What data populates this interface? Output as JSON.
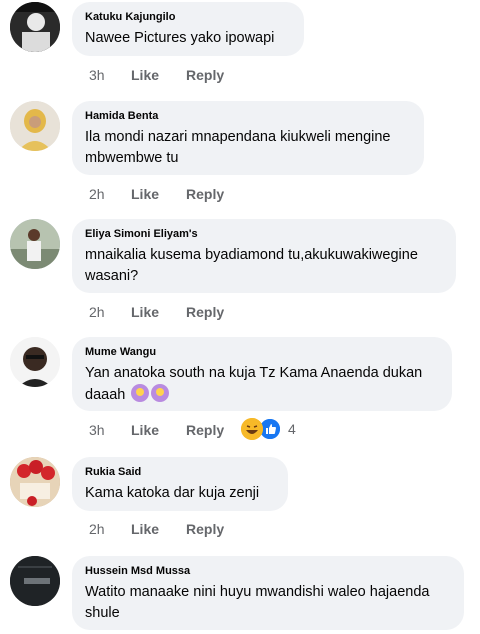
{
  "comments": [
    {
      "name": "Katuku Kajungilo",
      "text": "Nawee Pictures yako ipowapi",
      "time": "3h",
      "like": "Like",
      "reply": "Reply"
    },
    {
      "name": "Hamida Benta",
      "text": "Ila mondi nazari mnapendana kiukweli mengine mbwembwe tu",
      "time": "2h",
      "like": "Like",
      "reply": "Reply"
    },
    {
      "name": "Eliya Simoni Eliyam's",
      "text": "mnaikalia kusema byadiamond tu,akukuwakiwegine wasani?",
      "time": "2h",
      "like": "Like",
      "reply": "Reply"
    },
    {
      "name": "Mume Wangu",
      "text": "Yan anatoka south na kuja Tz Kama Anaenda dukan daaah",
      "time": "3h",
      "like": "Like",
      "reply": "Reply",
      "reactions": {
        "count": "4",
        "icons": [
          "haha-icon",
          "like-icon"
        ]
      }
    },
    {
      "name": "Rukia Said",
      "text": "Kama katoka dar kuja zenji",
      "time": "2h",
      "like": "Like",
      "reply": "Reply"
    },
    {
      "name": "Hussein Msd Mussa",
      "text": "Watito manaake nini huyu mwandishi waleo hajaenda shule"
    }
  ],
  "colors": {
    "bubble": "#f0f2f5",
    "meta": "#65676b",
    "text": "#050505",
    "like_reaction": "#1877f2",
    "haha_reaction": "#f7b928"
  }
}
